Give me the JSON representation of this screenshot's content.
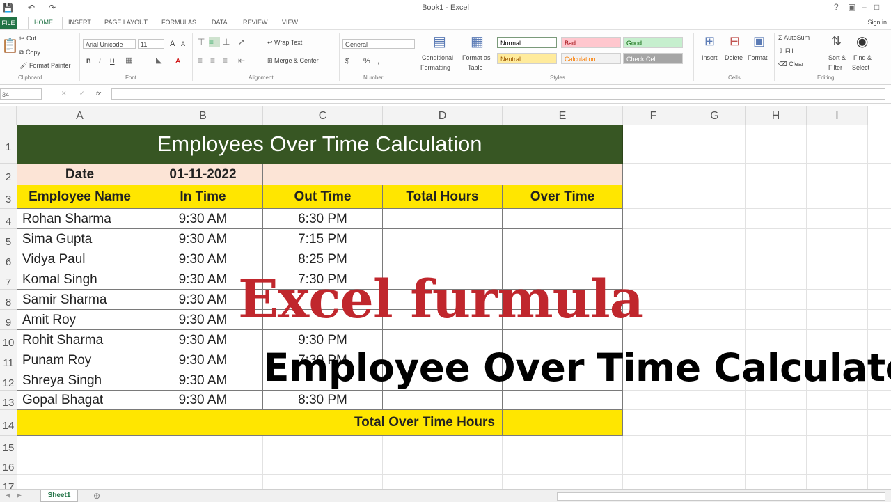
{
  "app": {
    "title": "Book1 - Excel",
    "quick_access": [
      "💾",
      "↶",
      "↷"
    ],
    "window_controls": [
      "?",
      "▣",
      "–",
      "□",
      "✕"
    ]
  },
  "ribbon_tabs": [
    "FILE",
    "HOME",
    "INSERT",
    "PAGE LAYOUT",
    "FORMULAS",
    "DATA",
    "REVIEW",
    "VIEW"
  ],
  "sign_in": "Sign in",
  "ribbon": {
    "clipboard": {
      "cut": "Cut",
      "copy": "Copy",
      "format_painter": "Format Painter",
      "paste": "Paste",
      "group": "Clipboard"
    },
    "font": {
      "name": "Arial Unicode",
      "size": "11",
      "bold": "B",
      "italic": "I",
      "underline": "U",
      "grow": "A",
      "shrink": "A",
      "font_color": "A",
      "group": "Font"
    },
    "alignment": {
      "wrap_text": "Wrap Text",
      "merge_center": "Merge & Center",
      "group": "Alignment"
    },
    "number": {
      "format": "General",
      "currency": "$",
      "percent": "%",
      "comma": ",",
      "group": "Number"
    },
    "styles": {
      "conditional": "Conditional",
      "conditional2": "Formatting",
      "format_as": "Format as",
      "format_as2": "Table",
      "cells": [
        {
          "label": "Normal",
          "bg": "#ffffff",
          "fg": "#000000"
        },
        {
          "label": "Bad",
          "bg": "#ffc7ce",
          "fg": "#9c0006"
        },
        {
          "label": "Good",
          "bg": "#c6efce",
          "fg": "#006100"
        },
        {
          "label": "Neutral",
          "bg": "#ffeb9c",
          "fg": "#9c5700"
        },
        {
          "label": "Calculation",
          "bg": "#f2f2f2",
          "fg": "#fa7d00"
        },
        {
          "label": "Check Cell",
          "bg": "#a5a5a5",
          "fg": "#ffffff"
        }
      ],
      "group": "Styles"
    },
    "cells": {
      "insert": "Insert",
      "delete": "Delete",
      "format": "Format",
      "group": "Cells"
    },
    "editing": {
      "autosum": "AutoSum",
      "fill": "Fill",
      "clear": "Clear",
      "sort": "Sort &",
      "sort2": "Filter",
      "find": "Find &",
      "find2": "Select",
      "group": "Editing"
    }
  },
  "formula_bar": {
    "name_box": "34",
    "fx": "fx",
    "cancel": "✕",
    "enter": "✓",
    "value": ""
  },
  "columns": [
    "A",
    "B",
    "C",
    "D",
    "E",
    "F",
    "G",
    "H",
    "I"
  ],
  "rows": [
    "1",
    "2",
    "3",
    "4",
    "5",
    "6",
    "7",
    "8",
    "9",
    "10",
    "11",
    "12",
    "13",
    "14",
    "15",
    "16",
    "17"
  ],
  "sheet": {
    "title": "Employees Over Time Calculation",
    "date_label": "Date",
    "date_value": "01-11-2022",
    "headers": [
      "Employee Name",
      "In Time",
      "Out Time",
      "Total Hours",
      "Over Time"
    ],
    "employees": [
      {
        "name": "Rohan Sharma",
        "in": "9:30 AM",
        "out": "6:30 PM"
      },
      {
        "name": "Sima Gupta",
        "in": "9:30 AM",
        "out": "7:15 PM"
      },
      {
        "name": "Vidya Paul",
        "in": "9:30 AM",
        "out": "8:25 PM"
      },
      {
        "name": "Komal Singh",
        "in": "9:30 AM",
        "out": "7:30 PM"
      },
      {
        "name": "Samir Sharma",
        "in": "9:30 AM",
        "out": ""
      },
      {
        "name": "Amit Roy",
        "in": "9:30 AM",
        "out": ""
      },
      {
        "name": "Rohit Sharma",
        "in": "9:30 AM",
        "out": "9:30 PM"
      },
      {
        "name": "Punam Roy",
        "in": "9:30 AM",
        "out": "7:30 PM"
      },
      {
        "name": "Shreya Singh",
        "in": "9:30 AM",
        "out": ""
      },
      {
        "name": "Gopal Bhagat",
        "in": "9:30 AM",
        "out": "8:30 PM"
      }
    ],
    "total_label": "Total Over Time Hours",
    "title_bg": "#375623",
    "date_row_bg": "#fce4d6",
    "header_bg": "#ffe600"
  },
  "overlay": {
    "line1": "Excel furmula",
    "line2": "Employee Over Time Calculate",
    "line1_color": "#c0272d"
  },
  "sheet_tabs": [
    "Sheet1"
  ],
  "add_sheet": "⊕"
}
